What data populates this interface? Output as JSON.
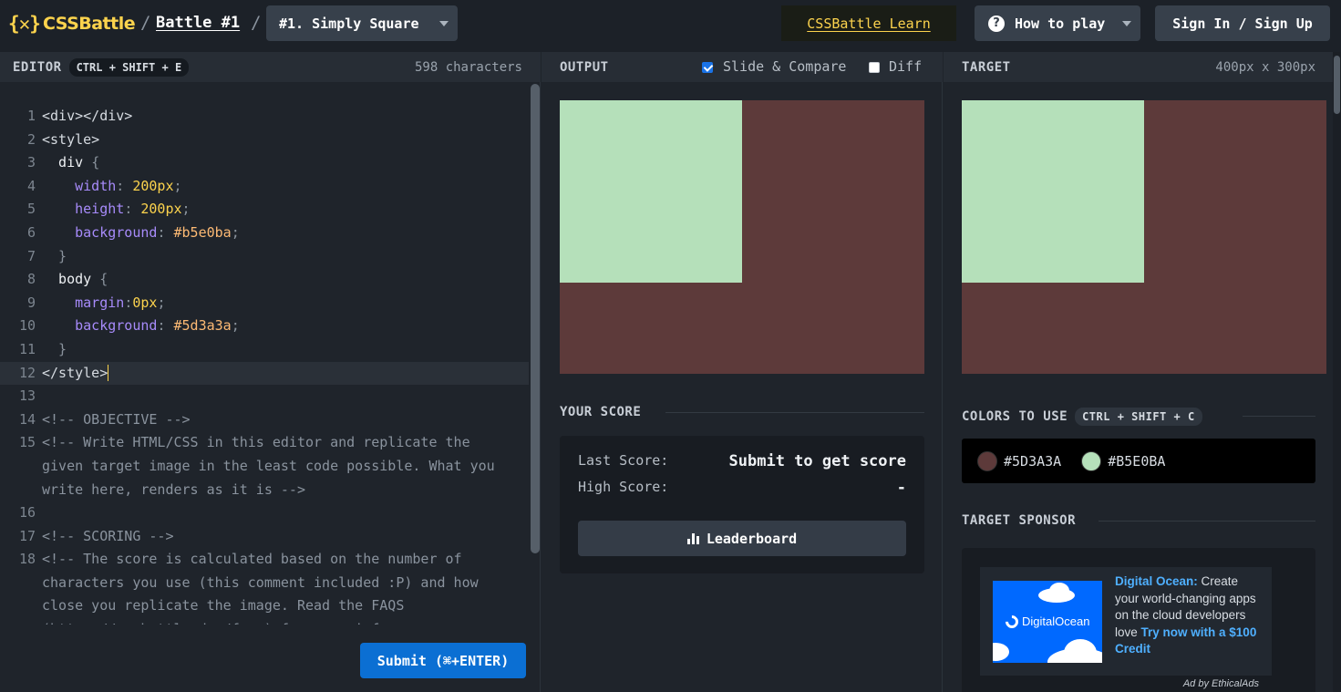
{
  "header": {
    "logo_mark": "{✕}",
    "logo_text": "CSSBattle",
    "separator": "/",
    "battle_link": "Battle #1",
    "target_select": "#1. Simply Square",
    "learn_link": "CSSBattle Learn",
    "how_to_play": "How to play",
    "how_to_play_icon": "?",
    "sign_in": "Sign In / Sign Up"
  },
  "editor": {
    "title": "EDITOR",
    "shortcut": "CTRL + SHIFT + E",
    "char_count": "598 characters",
    "submit": "Submit (⌘+ENTER)",
    "lines": [
      {
        "n": "1",
        "parts": [
          [
            "tag",
            "<div></div>"
          ]
        ]
      },
      {
        "n": "2",
        "parts": [
          [
            "tag",
            "<style>"
          ]
        ]
      },
      {
        "n": "3",
        "parts": [
          [
            "sel",
            "  div "
          ],
          [
            "pun",
            "{"
          ]
        ]
      },
      {
        "n": "4",
        "parts": [
          [
            "prop",
            "    width"
          ],
          [
            "pun",
            ": "
          ],
          [
            "num",
            "200px"
          ],
          [
            "pun",
            ";"
          ]
        ]
      },
      {
        "n": "5",
        "parts": [
          [
            "prop",
            "    height"
          ],
          [
            "pun",
            ": "
          ],
          [
            "num",
            "200px"
          ],
          [
            "pun",
            ";"
          ]
        ]
      },
      {
        "n": "6",
        "parts": [
          [
            "prop",
            "    background"
          ],
          [
            "pun",
            ": "
          ],
          [
            "col",
            "#b5e0ba"
          ],
          [
            "pun",
            ";"
          ]
        ]
      },
      {
        "n": "7",
        "parts": [
          [
            "pun",
            "  }"
          ]
        ]
      },
      {
        "n": "8",
        "parts": [
          [
            "sel",
            "  body "
          ],
          [
            "pun",
            "{"
          ]
        ]
      },
      {
        "n": "9",
        "parts": [
          [
            "prop",
            "    margin"
          ],
          [
            "pun",
            ":"
          ],
          [
            "num",
            "0px"
          ],
          [
            "pun",
            ";"
          ]
        ]
      },
      {
        "n": "10",
        "parts": [
          [
            "prop",
            "    background"
          ],
          [
            "pun",
            ": "
          ],
          [
            "col",
            "#5d3a3a"
          ],
          [
            "pun",
            ";"
          ]
        ]
      },
      {
        "n": "11",
        "parts": [
          [
            "pun",
            "  }"
          ]
        ]
      },
      {
        "n": "12",
        "parts": [
          [
            "tag",
            "</style>"
          ]
        ],
        "active": true
      },
      {
        "n": "13",
        "parts": []
      },
      {
        "n": "14",
        "parts": [
          [
            "cmt",
            "<!-- OBJECTIVE -->"
          ]
        ]
      },
      {
        "n": "15",
        "parts": [
          [
            "cmt",
            "<!-- Write HTML/CSS in this editor and replicate the"
          ]
        ]
      },
      {
        "n": "",
        "parts": [
          [
            "cmt",
            "given target image in the least code possible. What you"
          ]
        ]
      },
      {
        "n": "",
        "parts": [
          [
            "cmt",
            "write here, renders as it is -->"
          ]
        ]
      },
      {
        "n": "16",
        "parts": []
      },
      {
        "n": "17",
        "parts": [
          [
            "cmt",
            "<!-- SCORING -->"
          ]
        ]
      },
      {
        "n": "18",
        "parts": [
          [
            "cmt",
            "<!-- The score is calculated based on the number of"
          ]
        ]
      },
      {
        "n": "",
        "parts": [
          [
            "cmt",
            "characters you use (this comment included :P) and how"
          ]
        ]
      },
      {
        "n": "",
        "parts": [
          [
            "cmt",
            "close you replicate the image. Read the FAQS"
          ]
        ]
      },
      {
        "n": "",
        "parts": [
          [
            "cmt",
            "(https://cssbattle.dev/faqs) for more info. -->"
          ]
        ]
      }
    ]
  },
  "output": {
    "title": "OUTPUT",
    "slide_compare": "Slide & Compare",
    "slide_compare_checked": true,
    "diff": "Diff",
    "diff_checked": false,
    "your_score": "YOUR SCORE",
    "last_score_label": "Last Score:",
    "last_score_value": "Submit to get score",
    "high_score_label": "High Score:",
    "high_score_value": "-",
    "leaderboard": "Leaderboard"
  },
  "target": {
    "title": "TARGET",
    "size": "400px x 300px",
    "colors_title": "COLORS TO USE",
    "colors_shortcut": "CTRL + SHIFT + C",
    "colors": [
      {
        "hex": "#5D3A3A",
        "value": "#5d3a3a"
      },
      {
        "hex": "#B5E0BA",
        "value": "#b5e0ba"
      }
    ],
    "sponsor_title": "TARGET SPONSOR",
    "ad_brand": "Digital Ocean:",
    "ad_body": " Create your world-changing apps on the cloud developers love ",
    "ad_cta": "Try now with a $100 Credit",
    "ad_logo_text": "DigitalOcean",
    "ad_by": "Ad by EthicalAds"
  },
  "canvas_colors": {
    "background": "#5d3a3a",
    "square": "#b5e0ba"
  }
}
